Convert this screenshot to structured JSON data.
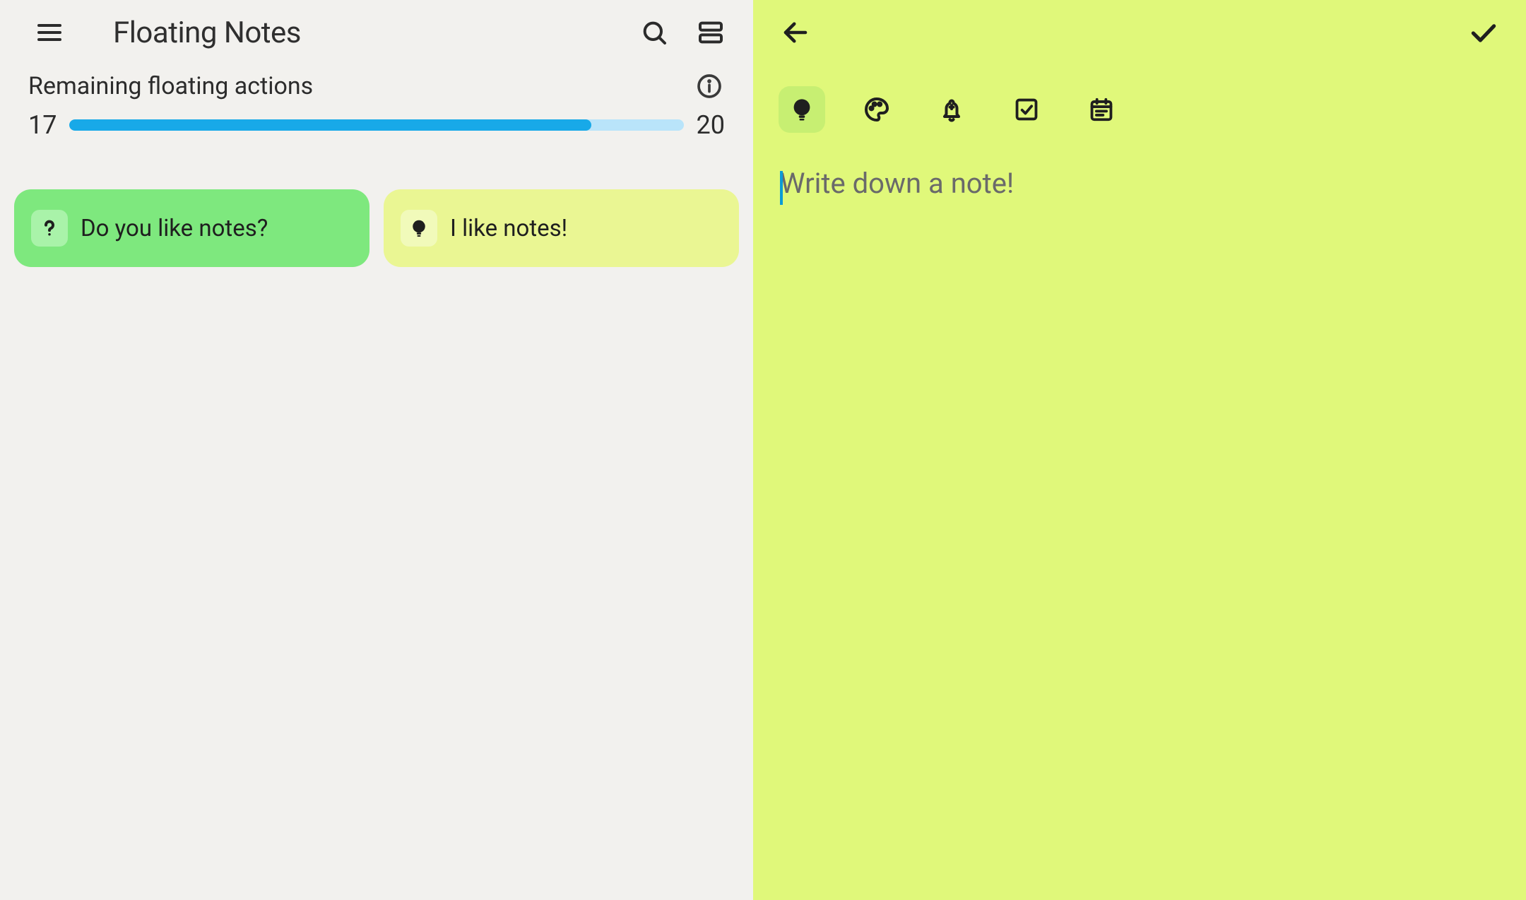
{
  "left": {
    "title": "Floating Notes",
    "quota": {
      "label": "Remaining floating actions",
      "current": "17",
      "max": "20",
      "percent": 85
    },
    "notes": [
      {
        "icon": "question",
        "text": "Do you like notes?",
        "color": "green"
      },
      {
        "icon": "lightbulb",
        "text": "I like notes!",
        "color": "yellow"
      }
    ]
  },
  "right": {
    "editor_placeholder": "Write down a note!",
    "toolbar": {
      "active_index": 0,
      "items": [
        "lightbulb",
        "palette",
        "reminder",
        "checkbox",
        "event-note"
      ]
    }
  },
  "colors": {
    "left_bg": "#f2f1ee",
    "right_bg": "#e0f87a",
    "note_green": "#7ee87e",
    "note_yellow": "#eaf693",
    "progress_fill": "#18a9e8",
    "progress_track": "#b9e4fa",
    "caret": "#0a9bd6"
  },
  "icons": {
    "menu": "menu-icon",
    "search": "search-icon",
    "view-agenda": "view-agenda-icon",
    "info": "info-icon",
    "back": "arrow-back-icon",
    "confirm": "check-icon",
    "question": "question-icon",
    "lightbulb": "lightbulb-icon",
    "palette": "palette-icon",
    "reminder": "reminder-icon",
    "checkbox": "checkbox-icon",
    "event-note": "event-note-icon"
  }
}
